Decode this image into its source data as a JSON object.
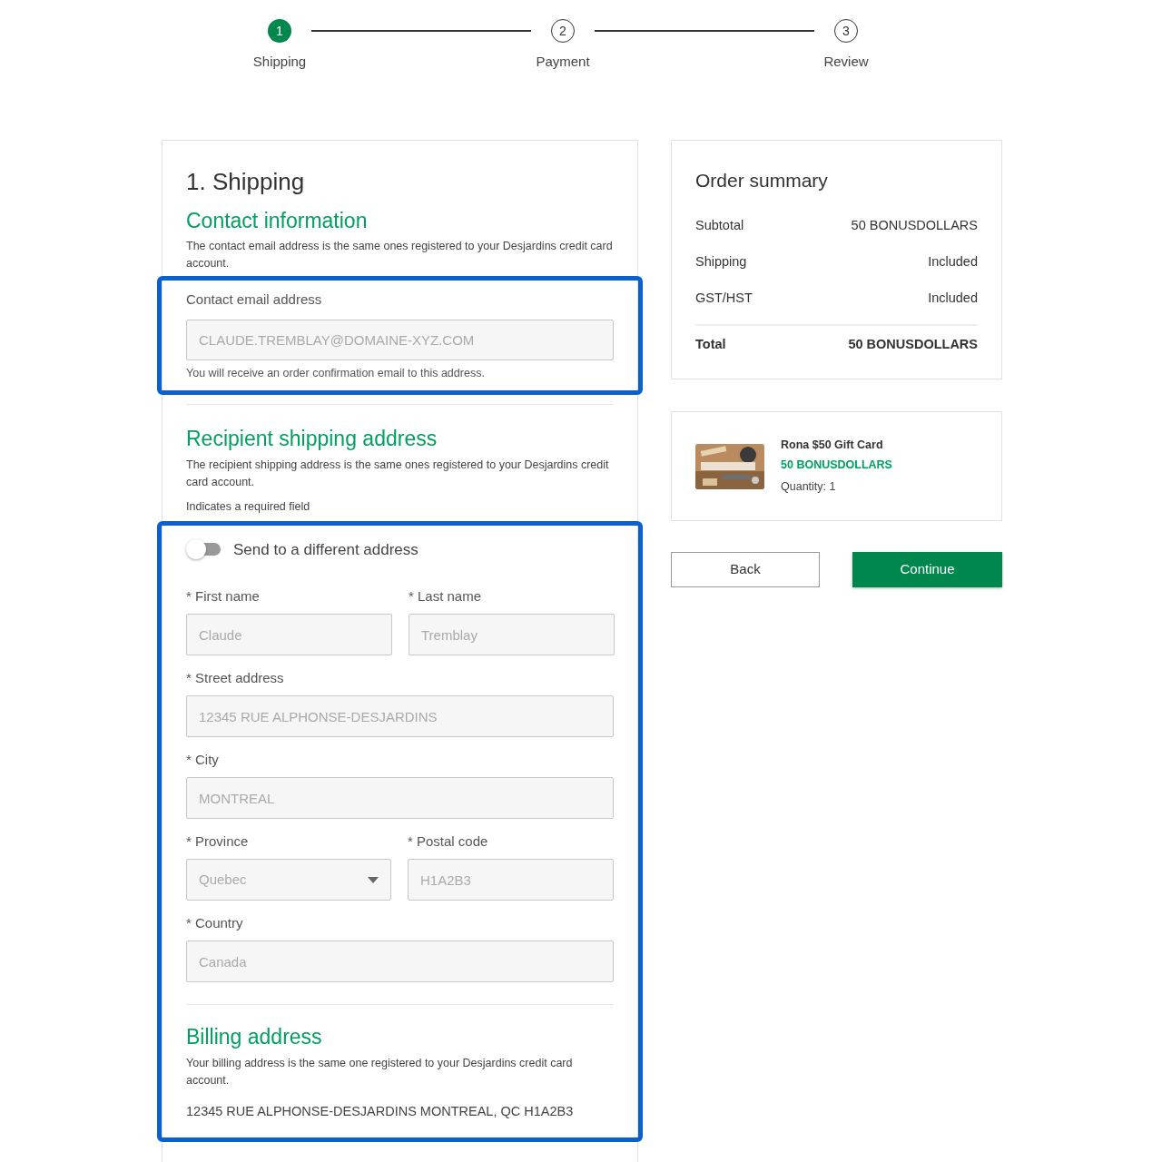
{
  "stepper": [
    {
      "number": "1",
      "label": "Shipping",
      "selected": true
    },
    {
      "number": "2",
      "label": "Payment",
      "selected": false
    },
    {
      "number": "3",
      "label": "Review",
      "selected": false
    }
  ],
  "shipping": {
    "title": "1. Shipping",
    "contact": {
      "heading": "Contact information",
      "description": "The contact email address is the same ones registered to your Desjardins credit card account.",
      "highlighted": true,
      "email_label": "Contact email address",
      "email_value": "CLAUDE.TREMBLAY@DOMAINE-XYZ.COM",
      "email_disabled": true,
      "email_hint": "You will receive an order confirmation email to this address."
    },
    "recipient": {
      "heading": "Recipient shipping address",
      "description": "The recipient shipping address is the same ones registered to your Desjardins credit card account.",
      "required_note": "Indicates a required field"
    },
    "address_block": {
      "highlighted": true,
      "toggle": {
        "label": "Send to a different address",
        "on": false
      },
      "rows": [
        [
          {
            "kind": "text",
            "label": "* First name",
            "value": "Claude",
            "disabled": true
          },
          {
            "kind": "text",
            "label": "* Last name",
            "value": "Tremblay",
            "disabled": true
          }
        ],
        [
          {
            "kind": "text",
            "label": "* Street address",
            "value": "12345 RUE ALPHONSE-DESJARDINS",
            "disabled": true
          }
        ],
        [
          {
            "kind": "text",
            "label": "* City",
            "value": "MONTREAL",
            "disabled": true
          }
        ],
        [
          {
            "kind": "select",
            "label": "* Province",
            "value": "Quebec",
            "disabled": true
          },
          {
            "kind": "text",
            "label": "* Postal code",
            "value": "H1A2B3",
            "disabled": true
          }
        ],
        [
          {
            "kind": "text",
            "label": "* Country",
            "value": "Canada",
            "disabled": true
          }
        ]
      ],
      "billing": {
        "heading": "Billing address",
        "description": "Your billing address is the same one registered to your Desjardins credit card account.",
        "address": "12345 RUE ALPHONSE-DESJARDINS MONTREAL, QC H1A2B3"
      }
    }
  },
  "order_summary": {
    "title": "Order summary",
    "rows": [
      {
        "label": "Subtotal",
        "value": "50 BONUSDOLLARS",
        "kind": "line"
      },
      {
        "label": "Shipping",
        "value": "Included",
        "kind": "line"
      },
      {
        "label": "GST/HST",
        "value": "Included",
        "kind": "line"
      },
      {
        "label": "Total",
        "value": "50 BONUSDOLLARS",
        "kind": "total"
      }
    ]
  },
  "product": {
    "name": "Rona $50 Gift Card",
    "price": "50 BONUSDOLLARS",
    "quantity": "Quantity: 1"
  },
  "buttons": [
    {
      "label": "Back",
      "kind": "secondary"
    },
    {
      "label": "Continue",
      "kind": "primary"
    }
  ]
}
